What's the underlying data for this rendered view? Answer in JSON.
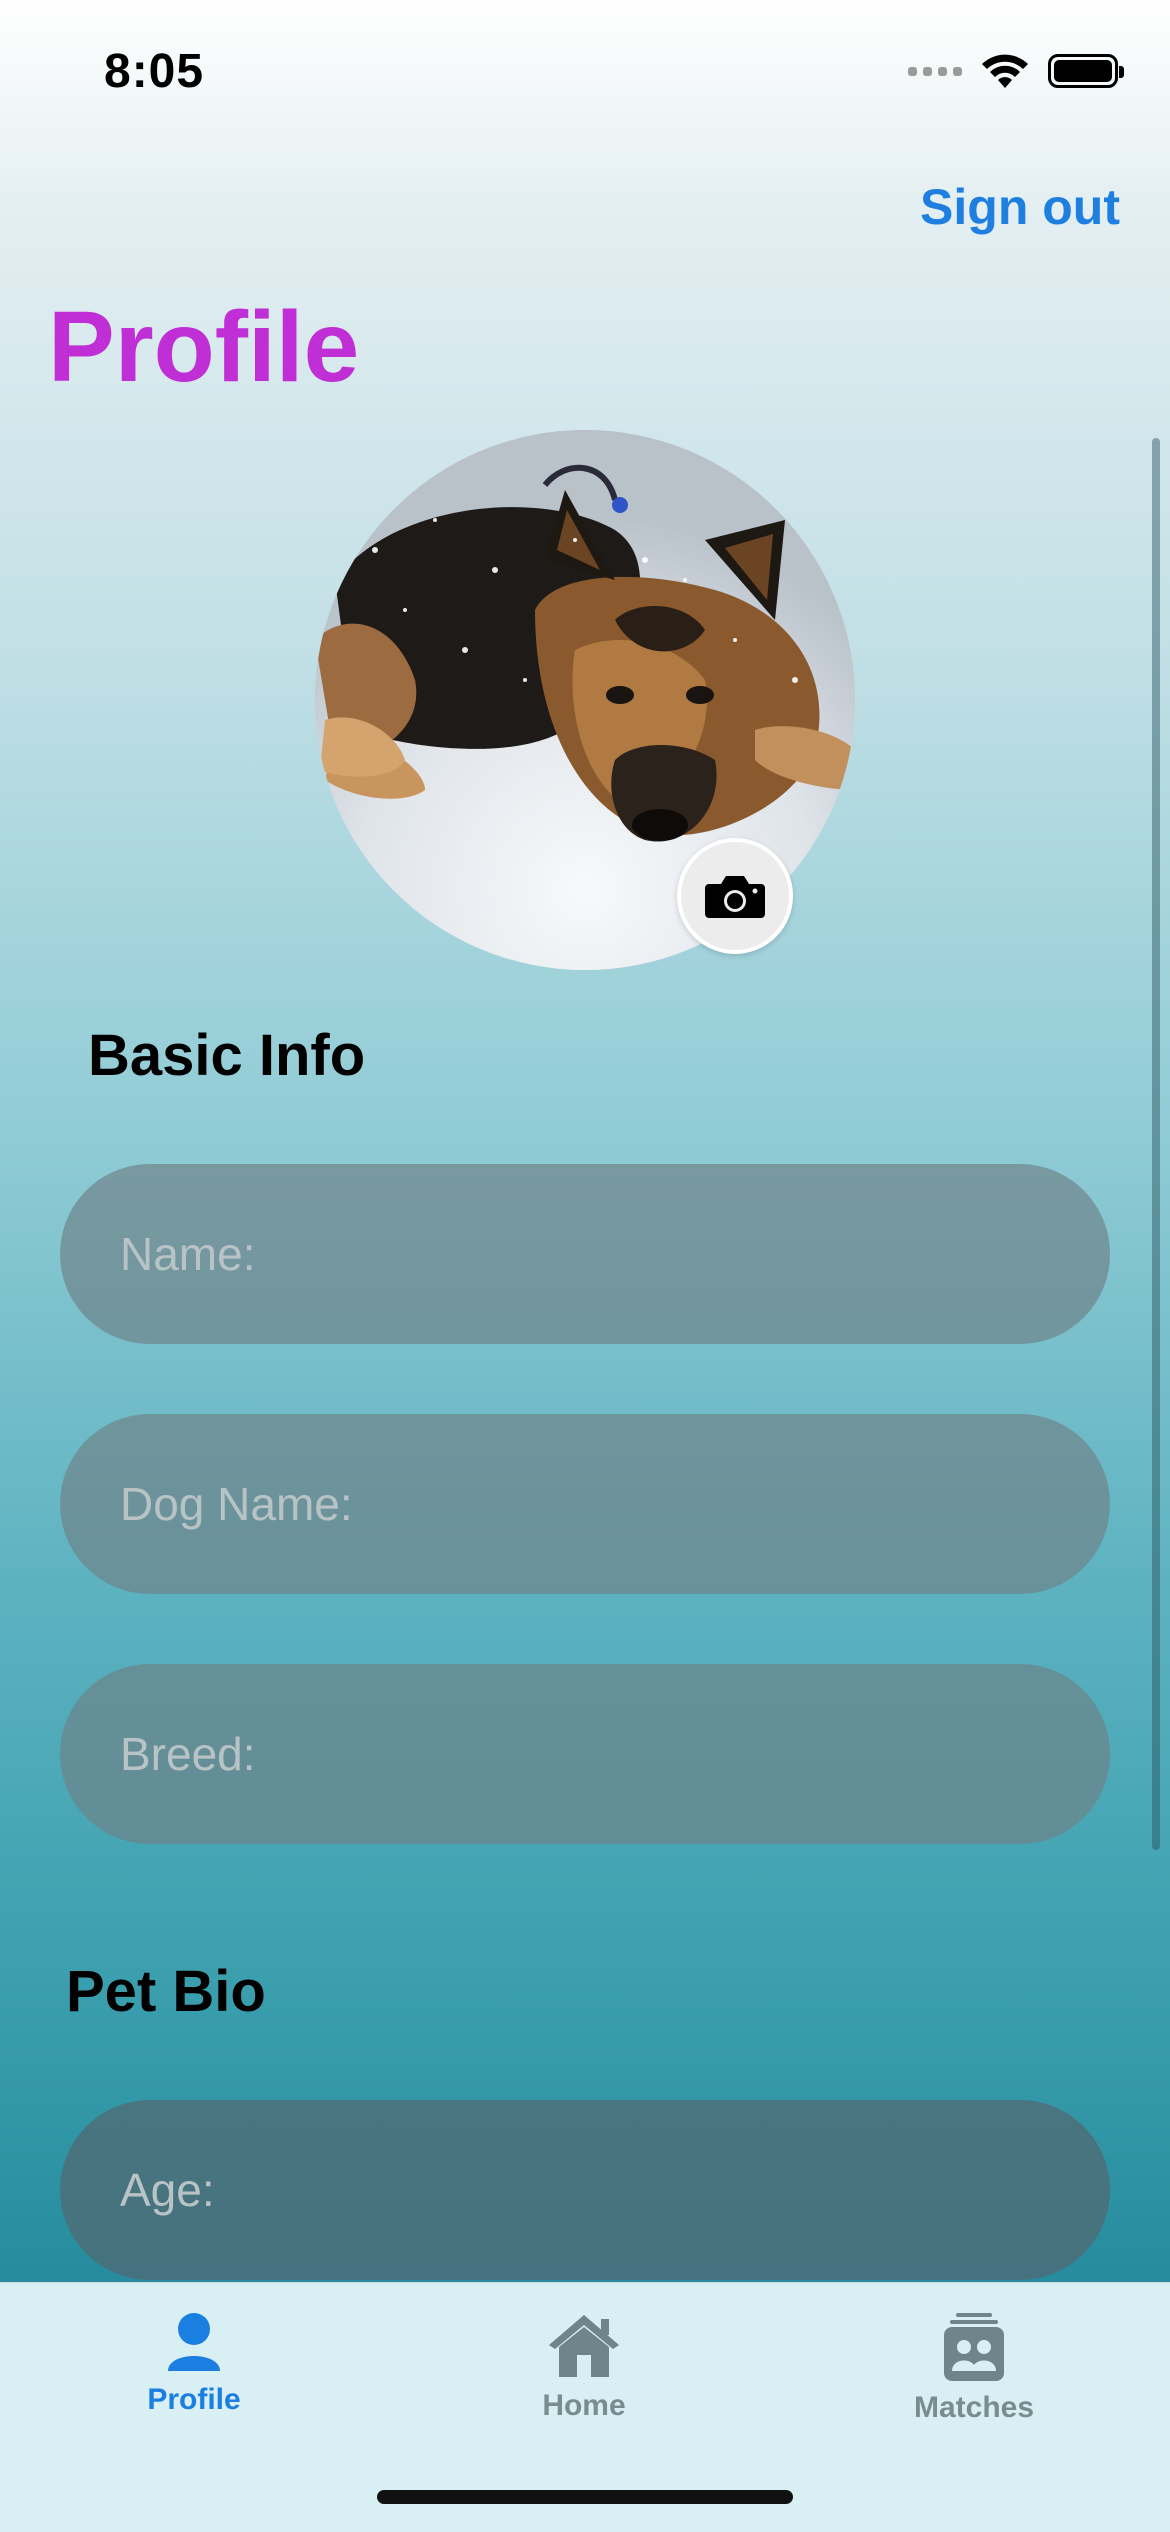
{
  "status_bar": {
    "time": "8:05"
  },
  "header": {
    "sign_out_label": "Sign out",
    "title": "Profile"
  },
  "colors": {
    "accent": "#1f7fe0",
    "title": "#c02fd6"
  },
  "sections": {
    "basic_info": {
      "title": "Basic Info",
      "fields": [
        {
          "placeholder": "Name:"
        },
        {
          "placeholder": "Dog Name:"
        },
        {
          "placeholder": "Breed:"
        }
      ]
    },
    "pet_bio": {
      "title": "Pet Bio",
      "fields": [
        {
          "placeholder": "Age:"
        }
      ]
    }
  },
  "tab_bar": {
    "tabs": [
      {
        "label": "Profile",
        "icon": "person-icon",
        "active": true
      },
      {
        "label": "Home",
        "icon": "house-icon",
        "active": false
      },
      {
        "label": "Matches",
        "icon": "matches-icon",
        "active": false
      }
    ]
  }
}
